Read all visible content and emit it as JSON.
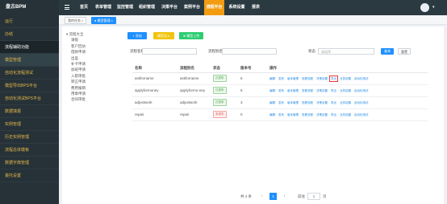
{
  "app": {
    "logo": "盘古BPM"
  },
  "sidebar": {
    "items": [
      {
        "label": "运行",
        "type": "normal"
      },
      {
        "label": "办结",
        "type": "normal"
      },
      {
        "label": "流程辅助功能",
        "type": "group"
      },
      {
        "label": "模型管理",
        "type": "active"
      },
      {
        "label": "自动化流程测试",
        "type": "normal"
      },
      {
        "label": "模型导出BPS平台",
        "type": "normal"
      },
      {
        "label": "自动化测试BPS平台",
        "type": "normal"
      },
      {
        "label": "数据填报",
        "type": "normal"
      },
      {
        "label": "实例管理",
        "type": "normal"
      },
      {
        "label": "历史实例管理",
        "type": "normal"
      },
      {
        "label": "流程总体模板",
        "type": "normal"
      },
      {
        "label": "数据字典管理",
        "type": "normal"
      },
      {
        "label": "委托设置",
        "type": "normal"
      }
    ]
  },
  "topnav": {
    "items": [
      {
        "label": "首页",
        "active": false
      },
      {
        "label": "表单管理",
        "active": false
      },
      {
        "label": "监控管理",
        "active": false
      },
      {
        "label": "组织管理",
        "active": false
      },
      {
        "label": "决策平台",
        "active": false
      },
      {
        "label": "案例平台",
        "active": false
      },
      {
        "label": "流程平台",
        "active": true
      },
      {
        "label": "系统设置",
        "active": false
      },
      {
        "label": "报表",
        "active": false
      }
    ],
    "caret": "▾"
  },
  "tabs": [
    {
      "label": "我的任务 ×",
      "active": false
    },
    {
      "label": "● 模型管理 ×",
      "active": true
    }
  ],
  "tree": {
    "root": "▾ 流程大全",
    "items": [
      "请假",
      "客户回访",
      "借款申请",
      "出差",
      "补卡申请",
      "加班申请",
      "入职审批",
      "转正申请",
      "费用报销",
      "用章申请",
      "合同审批"
    ]
  },
  "toolbar": {
    "add": "+ 添加",
    "import": "模型导入",
    "upload": "⊕ 模型上传"
  },
  "search": {
    "name_label": "流程名称",
    "name_placeholder": "",
    "alias_label": "流程别名",
    "alias_placeholder": "",
    "status_label": "状态",
    "status_value": "请选择",
    "query": "查询",
    "reset": "重置"
  },
  "table": {
    "headers": [
      "名称",
      "流程别名",
      "状态",
      "版本号",
      "操作"
    ],
    "ops": [
      "编辑",
      "发布",
      "版本管理",
      "查看流程",
      "决策设置",
      "导出",
      "业务设置",
      "自动化测试"
    ],
    "rows": [
      {
        "name": "askforname",
        "alias": "askforname",
        "status": "已发布",
        "status_type": "on",
        "version": "6"
      },
      {
        "name": "applyformoney",
        "alias": "applyformo-ney",
        "status": "已发布",
        "status_type": "on",
        "version": "5"
      },
      {
        "name": "adjustwork",
        "alias": "adjustwork",
        "status": "已发布",
        "status_type": "on",
        "version": "3"
      },
      {
        "name": "repair",
        "alias": "repair",
        "status": "未发布",
        "status_type": "off",
        "version": "0"
      }
    ]
  },
  "pager": {
    "total": "共 4 条",
    "prev": "‹",
    "page": "1",
    "next": "›",
    "goto_label": "前往",
    "goto_value": "1",
    "page_unit": "页"
  },
  "colors": {
    "sidebar_bg": "#263238",
    "accent": "#f39c12",
    "primary": "#1e90ff",
    "success": "#2ecc71",
    "warning": "#f1c40f"
  }
}
